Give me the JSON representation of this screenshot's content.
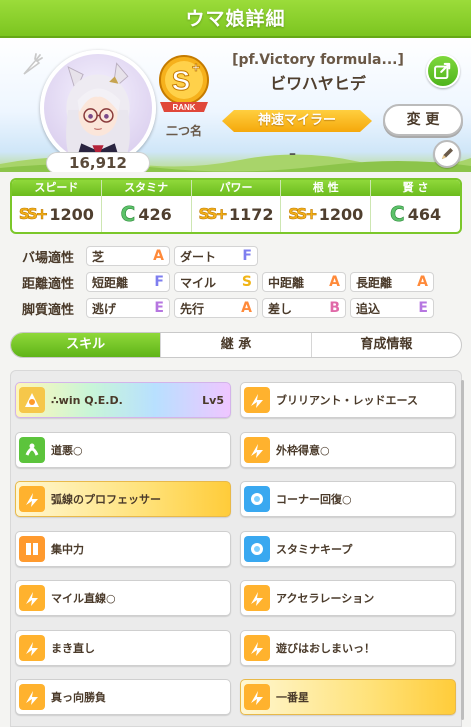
{
  "titlebar": {
    "title": "ウマ娘詳細"
  },
  "profile": {
    "epithet": "[pf.Victory formula...]",
    "name": "ビワハヤヒデ",
    "fans": "16,912",
    "rank_label": "RANK",
    "rank_grade": "S+",
    "title_label": "二つ名",
    "nickname": "神速マイラー",
    "change_label": "変 更",
    "sub_text": "–"
  },
  "stats": [
    {
      "label": "スピード",
      "grade": "SS+",
      "value": "1200",
      "icon": "speed-icon"
    },
    {
      "label": "スタミナ",
      "grade": "C",
      "value": "426",
      "icon": "heart-icon"
    },
    {
      "label": "パワー",
      "grade": "SS+",
      "value": "1172",
      "icon": "muscle-icon"
    },
    {
      "label": "根 性",
      "grade": "SS+",
      "value": "1200",
      "icon": "flame-icon"
    },
    {
      "label": "賢 さ",
      "grade": "C",
      "value": "464",
      "icon": "graduation-cap-icon"
    }
  ],
  "aptitude": {
    "field": {
      "label": "バ場適性",
      "items": [
        {
          "name": "芝",
          "grade": "A"
        },
        {
          "name": "ダート",
          "grade": "F"
        }
      ]
    },
    "distance": {
      "label": "距離適性",
      "items": [
        {
          "name": "短距離",
          "grade": "F"
        },
        {
          "name": "マイル",
          "grade": "S"
        },
        {
          "name": "中距離",
          "grade": "A"
        },
        {
          "name": "長距離",
          "grade": "A"
        }
      ]
    },
    "style": {
      "label": "脚質適性",
      "items": [
        {
          "name": "逃げ",
          "grade": "E"
        },
        {
          "name": "先行",
          "grade": "A"
        },
        {
          "name": "差し",
          "grade": "B"
        },
        {
          "name": "追込",
          "grade": "E"
        }
      ]
    }
  },
  "tabs": [
    {
      "label": "スキル"
    },
    {
      "label": "継 承"
    },
    {
      "label": "育成情報"
    }
  ],
  "skills": [
    {
      "name": "∴win Q.E.D.",
      "level": "Lv5",
      "style": "unique",
      "icon": "rainbow-skill-icon"
    },
    {
      "name": "ブリリアント・レッドエース",
      "style": "normal",
      "icon": "speed-skill-icon"
    },
    {
      "name": "道悪○",
      "style": "normal",
      "icon": "green-skill-icon"
    },
    {
      "name": "外枠得意○",
      "style": "normal",
      "icon": "speed-skill-icon"
    },
    {
      "name": "弧線のプロフェッサー",
      "style": "gold",
      "icon": "speed-skill-icon"
    },
    {
      "name": "コーナー回復○",
      "style": "normal",
      "icon": "recovery-skill-icon"
    },
    {
      "name": "集中力",
      "style": "normal",
      "icon": "gate-skill-icon"
    },
    {
      "name": "スタミナキープ",
      "style": "normal",
      "icon": "recovery-skill-icon"
    },
    {
      "name": "マイル直線○",
      "style": "normal",
      "icon": "speed-skill-icon"
    },
    {
      "name": "アクセラレーション",
      "style": "normal",
      "icon": "speed-skill-icon"
    },
    {
      "name": "まき直し",
      "style": "normal",
      "icon": "speed-skill-icon"
    },
    {
      "name": "遊びはおしまいっ！",
      "style": "normal",
      "icon": "speed-skill-icon"
    },
    {
      "name": "真っ向勝負",
      "style": "normal",
      "icon": "speed-skill-icon"
    },
    {
      "name": "一番星",
      "style": "gold",
      "icon": "speed-skill-icon"
    }
  ],
  "colors": {
    "accent_green": "#7cc520",
    "nickname_gold": "#f5a80b",
    "panel_bg": "#ebebeb"
  }
}
